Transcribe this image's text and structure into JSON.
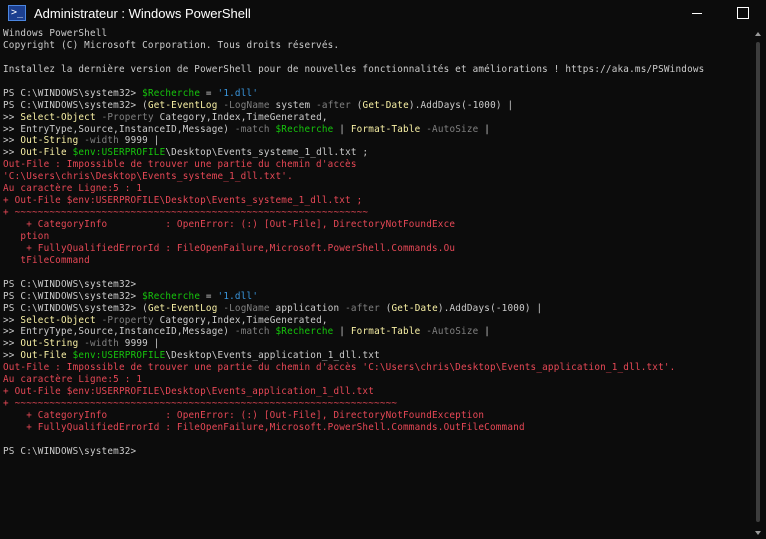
{
  "window": {
    "title": "Administrateur : Windows PowerShell",
    "icon_label": ">_",
    "controls": {
      "minimize": "—",
      "maximize": "□"
    }
  },
  "colors": {
    "background": "#0c0c0c",
    "text": "#cccccc",
    "command": "#f9f1a5",
    "parameter": "#808080",
    "variable": "#16c60c",
    "string": "#3a96dd",
    "error": "#e74856"
  },
  "terminal": {
    "lines": [
      [
        [
          "Windows PowerShell",
          "c-white"
        ]
      ],
      [
        [
          "Copyright (C) Microsoft Corporation. Tous droits réservés.",
          "c-white"
        ]
      ],
      [],
      [
        [
          "Installez la dernière version de PowerShell pour de nouvelles fonctionnalités et améliorations ! https://aka.ms/PSWindows",
          "c-white"
        ]
      ],
      [],
      [
        [
          "PS C:\\WINDOWS\\system32> ",
          "c-white"
        ],
        [
          "$Recherche",
          "c-green"
        ],
        [
          " = ",
          "c-white"
        ],
        [
          "'1.dll'",
          "c-cyan"
        ]
      ],
      [
        [
          "PS C:\\WINDOWS\\system32> ",
          "c-white"
        ],
        [
          "(",
          "c-white"
        ],
        [
          "Get-EventLog",
          "c-yellow"
        ],
        [
          " -LogName ",
          "c-gray"
        ],
        [
          "system ",
          "c-white"
        ],
        [
          "-after ",
          "c-gray"
        ],
        [
          "(",
          "c-white"
        ],
        [
          "Get-Date",
          "c-yellow"
        ],
        [
          ").AddDays(",
          "c-white"
        ],
        [
          "-1000",
          "c-white"
        ],
        [
          ") |",
          "c-white"
        ]
      ],
      [
        [
          ">> ",
          "c-white"
        ],
        [
          "Select-Object",
          "c-yellow"
        ],
        [
          " -Property ",
          "c-gray"
        ],
        [
          "Category,Index,TimeGenerated,",
          "c-white"
        ]
      ],
      [
        [
          ">> EntryType,Source,InstanceID,Message) ",
          "c-white"
        ],
        [
          "-match ",
          "c-gray"
        ],
        [
          "$Recherche",
          "c-green"
        ],
        [
          " | ",
          "c-white"
        ],
        [
          "Format-Table",
          "c-yellow"
        ],
        [
          " -AutoSize",
          "c-gray"
        ],
        [
          " |",
          "c-white"
        ]
      ],
      [
        [
          ">> ",
          "c-white"
        ],
        [
          "Out-String",
          "c-yellow"
        ],
        [
          " -width ",
          "c-gray"
        ],
        [
          "9999",
          "c-white"
        ],
        [
          " |",
          "c-white"
        ]
      ],
      [
        [
          ">> ",
          "c-white"
        ],
        [
          "Out-File",
          "c-yellow"
        ],
        [
          " ",
          "c-white"
        ],
        [
          "$env:USERPROFILE",
          "c-green"
        ],
        [
          "\\Desktop\\Events_systeme_1_dll.txt ;",
          "c-white"
        ]
      ],
      [
        [
          "Out-File : Impossible de trouver une partie du chemin d'accès",
          "c-red"
        ]
      ],
      [
        [
          "'C:\\Users\\chris\\Desktop\\Events_systeme_1_dll.txt'.",
          "c-red"
        ]
      ],
      [
        [
          "Au caractère Ligne:5 : 1",
          "c-red"
        ]
      ],
      [
        [
          "+ Out-File $env:USERPROFILE\\Desktop\\Events_systeme_1_dll.txt ;",
          "c-red"
        ]
      ],
      [
        [
          "+ ~~~~~~~~~~~~~~~~~~~~~~~~~~~~~~~~~~~~~~~~~~~~~~~~~~~~~~~~~~~~~",
          "c-red"
        ]
      ],
      [
        [
          "    + CategoryInfo          : OpenError: (:) [Out-File], DirectoryNotFoundExce",
          "c-red"
        ]
      ],
      [
        [
          "   ption",
          "c-red"
        ]
      ],
      [
        [
          "    + FullyQualifiedErrorId : FileOpenFailure,Microsoft.PowerShell.Commands.Ou",
          "c-red"
        ]
      ],
      [
        [
          "   tFileCommand",
          "c-red"
        ]
      ],
      [],
      [
        [
          "PS C:\\WINDOWS\\system32>",
          "c-white"
        ]
      ],
      [
        [
          "PS C:\\WINDOWS\\system32> ",
          "c-white"
        ],
        [
          "$Recherche",
          "c-green"
        ],
        [
          " = ",
          "c-white"
        ],
        [
          "'1.dll'",
          "c-cyan"
        ]
      ],
      [
        [
          "PS C:\\WINDOWS\\system32> ",
          "c-white"
        ],
        [
          "(",
          "c-white"
        ],
        [
          "Get-EventLog",
          "c-yellow"
        ],
        [
          " -LogName ",
          "c-gray"
        ],
        [
          "application ",
          "c-white"
        ],
        [
          "-after ",
          "c-gray"
        ],
        [
          "(",
          "c-white"
        ],
        [
          "Get-Date",
          "c-yellow"
        ],
        [
          ").AddDays(",
          "c-white"
        ],
        [
          "-1000",
          "c-white"
        ],
        [
          ") |",
          "c-white"
        ]
      ],
      [
        [
          ">> ",
          "c-white"
        ],
        [
          "Select-Object",
          "c-yellow"
        ],
        [
          " -Property ",
          "c-gray"
        ],
        [
          "Category,Index,TimeGenerated,",
          "c-white"
        ]
      ],
      [
        [
          ">> EntryType,Source,InstanceID,Message) ",
          "c-white"
        ],
        [
          "-match ",
          "c-gray"
        ],
        [
          "$Recherche",
          "c-green"
        ],
        [
          " | ",
          "c-white"
        ],
        [
          "Format-Table",
          "c-yellow"
        ],
        [
          " -AutoSize",
          "c-gray"
        ],
        [
          " |",
          "c-white"
        ]
      ],
      [
        [
          ">> ",
          "c-white"
        ],
        [
          "Out-String",
          "c-yellow"
        ],
        [
          " -width ",
          "c-gray"
        ],
        [
          "9999",
          "c-white"
        ],
        [
          " |",
          "c-white"
        ]
      ],
      [
        [
          ">> ",
          "c-white"
        ],
        [
          "Out-File",
          "c-yellow"
        ],
        [
          " ",
          "c-white"
        ],
        [
          "$env:USERPROFILE",
          "c-green"
        ],
        [
          "\\Desktop\\Events_application_1_dll.txt",
          "c-white"
        ]
      ],
      [
        [
          "Out-File : Impossible de trouver une partie du chemin d'accès 'C:\\Users\\chris\\Desktop\\Events_application_1_dll.txt'.",
          "c-red"
        ]
      ],
      [
        [
          "Au caractère Ligne:5 : 1",
          "c-red"
        ]
      ],
      [
        [
          "+ Out-File $env:USERPROFILE\\Desktop\\Events_application_1_dll.txt",
          "c-red"
        ]
      ],
      [
        [
          "+ ~~~~~~~~~~~~~~~~~~~~~~~~~~~~~~~~~~~~~~~~~~~~~~~~~~~~~~~~~~~~~~~~~~",
          "c-red"
        ]
      ],
      [
        [
          "    + CategoryInfo          : OpenError: (:) [Out-File], DirectoryNotFoundException",
          "c-red"
        ]
      ],
      [
        [
          "    + FullyQualifiedErrorId : FileOpenFailure,Microsoft.PowerShell.Commands.OutFileCommand",
          "c-red"
        ]
      ],
      [],
      [
        [
          "PS C:\\WINDOWS\\system32>",
          "c-white"
        ]
      ]
    ]
  }
}
